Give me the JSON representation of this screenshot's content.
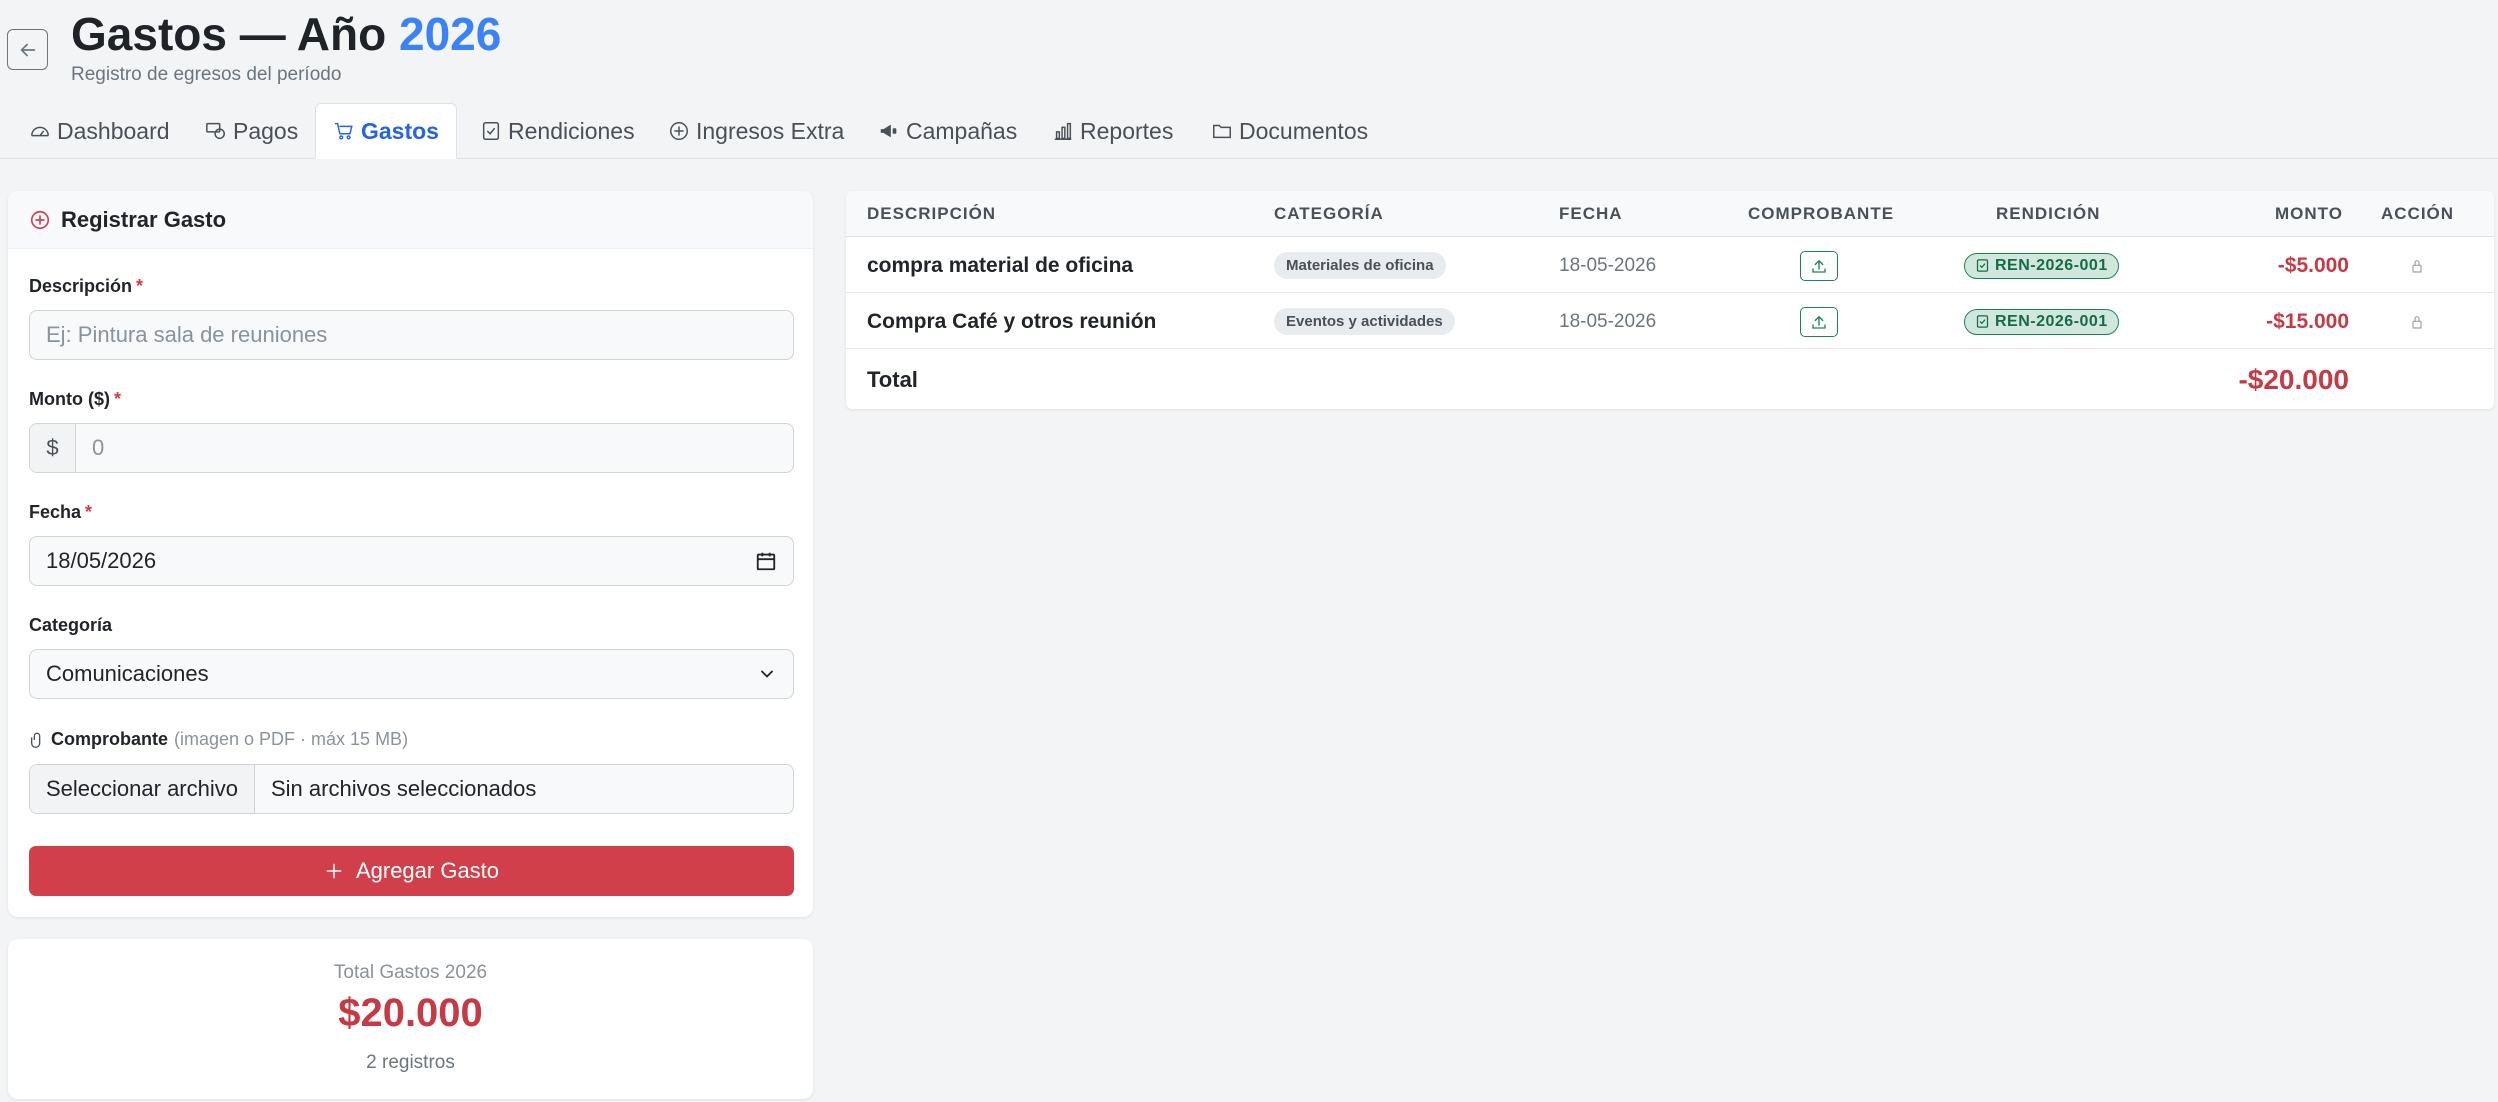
{
  "header": {
    "back_icon": "arrow-left-icon",
    "title_prefix": "Gastos — Año",
    "title_year": "2026",
    "subtitle": "Registro de egresos del período"
  },
  "tabs": [
    {
      "label": "Dashboard",
      "icon": "speedometer-icon"
    },
    {
      "label": "Pagos",
      "icon": "cash-coin-icon"
    },
    {
      "label": "Gastos",
      "icon": "cart-icon",
      "active": true
    },
    {
      "label": "Rendiciones",
      "icon": "clipboard-check-icon"
    },
    {
      "label": "Ingresos Extra",
      "icon": "plus-circle-icon"
    },
    {
      "label": "Campañas",
      "icon": "megaphone-icon"
    },
    {
      "label": "Reportes",
      "icon": "bar-chart-icon"
    },
    {
      "label": "Documentos",
      "icon": "folder-icon"
    }
  ],
  "form": {
    "title": "Registrar Gasto",
    "descripcion_label": "Descripción",
    "descripcion_placeholder": "Ej: Pintura sala de reuniones",
    "monto_label": "Monto ($)",
    "monto_prefix": "$",
    "monto_placeholder": "0",
    "fecha_label": "Fecha",
    "fecha_value": "18/05/2026",
    "required_mark": "*",
    "categoria_label": "Categoría",
    "categoria_value": "Comunicaciones",
    "comprobante_label": "Comprobante",
    "comprobante_hint": "(imagen o PDF · máx 15 MB)",
    "file_button": "Seleccionar archivo",
    "file_status": "Sin archivos seleccionados",
    "submit_label": "Agregar Gasto"
  },
  "summary": {
    "label": "Total Gastos 2026",
    "value": "$20.000",
    "count": "2 registros"
  },
  "table": {
    "columns": [
      "DESCRIPCIÓN",
      "CATEGORÍA",
      "FECHA",
      "COMPROBANTE",
      "RENDICIÓN",
      "MONTO",
      "ACCIÓN"
    ],
    "rows": [
      {
        "descripcion": "compra material de oficina",
        "categoria": "Materiales de oficina",
        "fecha": "18-05-2026",
        "rendicion": "REN-2026-001",
        "monto": "-$5.000"
      },
      {
        "descripcion": "Compra Café y otros reunión",
        "categoria": "Eventos y actividades",
        "fecha": "18-05-2026",
        "rendicion": "REN-2026-001",
        "monto": "-$15.000"
      }
    ],
    "total_label": "Total",
    "total_value": "-$20.000"
  },
  "colors": {
    "accent_blue": "#3b82f6",
    "danger": "#d1404a",
    "success": "#198754"
  }
}
